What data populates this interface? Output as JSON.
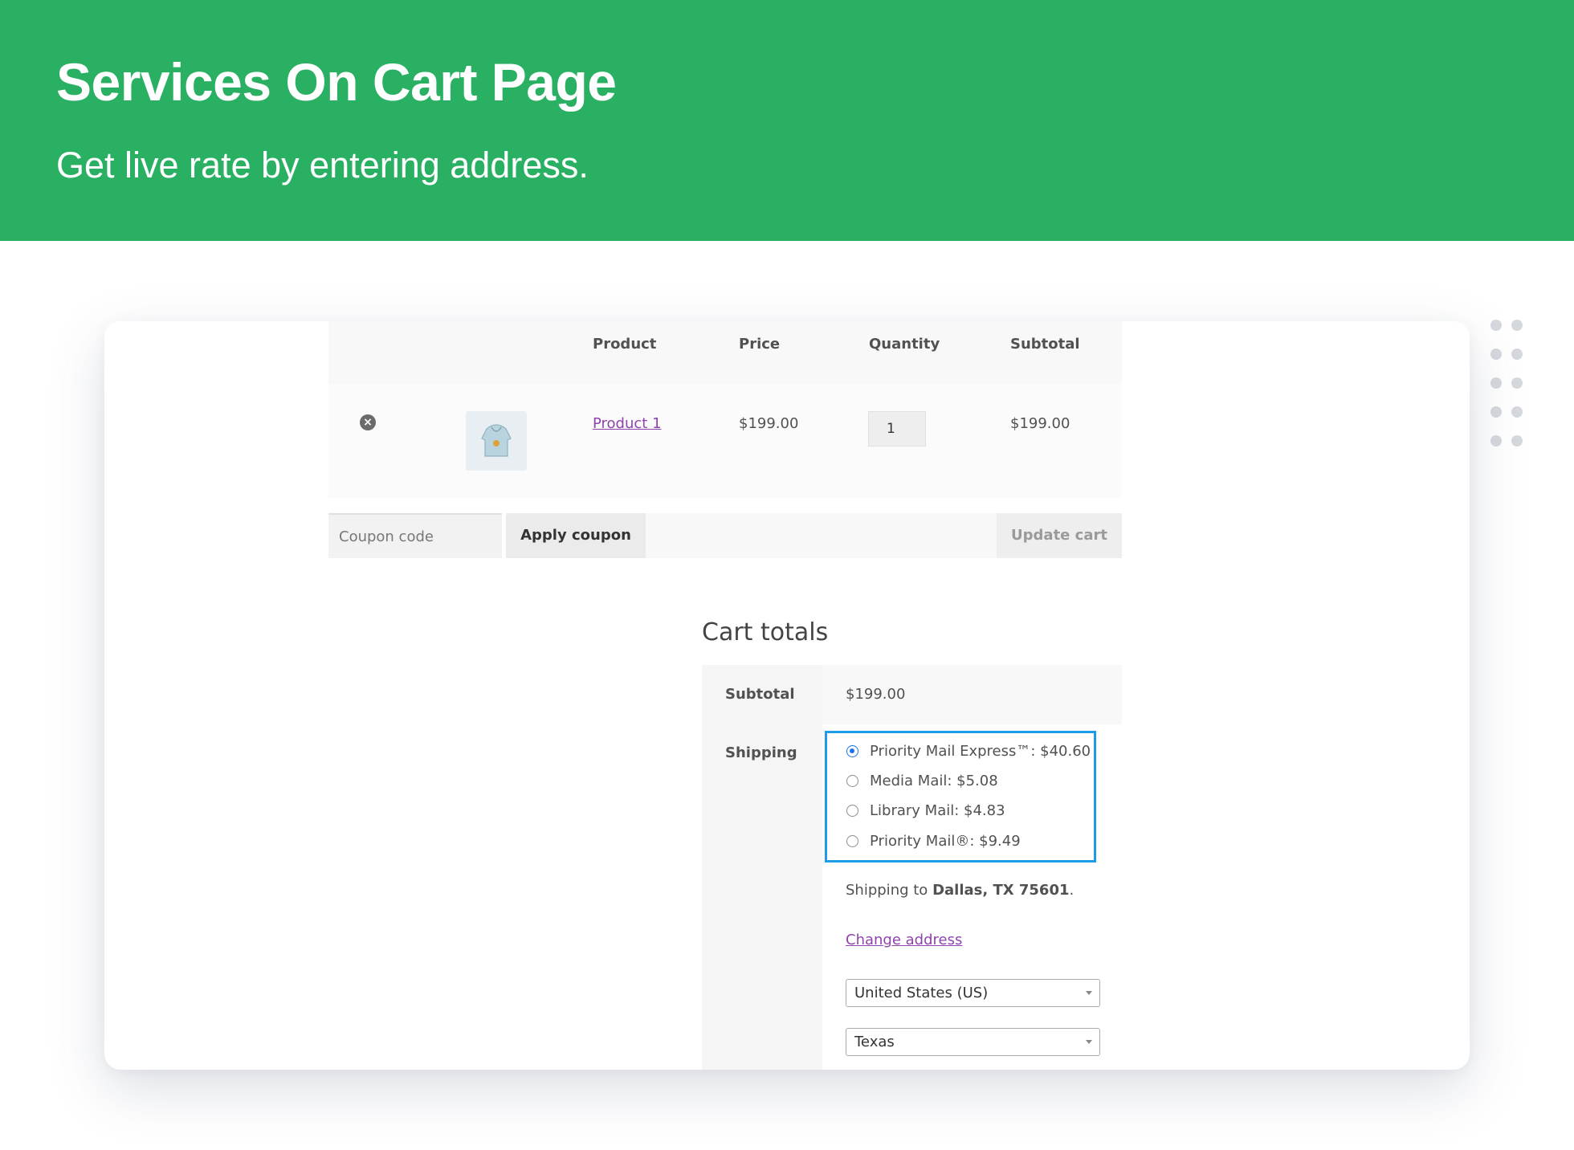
{
  "banner": {
    "title": "Services On Cart Page",
    "subtitle": "Get live rate by entering address.",
    "color": "#2ab063"
  },
  "cart": {
    "columns": [
      "Product",
      "Price",
      "Quantity",
      "Subtotal"
    ],
    "items": [
      {
        "name": "Product 1",
        "price": "$199.00",
        "quantity": "1",
        "subtotal": "$199.00",
        "remove_icon": "close-circle-icon",
        "thumbnail": "hoodie-thumbnail"
      }
    ],
    "coupon_placeholder": "Coupon code",
    "apply_coupon_label": "Apply coupon",
    "update_cart_label": "Update cart"
  },
  "totals": {
    "title": "Cart totals",
    "subtotal_label": "Subtotal",
    "subtotal_value": "$199.00",
    "shipping_label": "Shipping",
    "shipping_options": [
      {
        "label": "Priority Mail Express™: $40.60",
        "selected": true
      },
      {
        "label": "Media Mail: $5.08",
        "selected": false
      },
      {
        "label": "Library Mail: $4.83",
        "selected": false
      },
      {
        "label": "Priority Mail®: $9.49",
        "selected": false
      }
    ],
    "shipping_to_prefix": "Shipping to",
    "shipping_to_address": "Dallas, TX 75601",
    "shipping_to_suffix": ".",
    "change_address_label": "Change address",
    "country_value": "United States (US)",
    "state_value": "Texas",
    "highlight_color": "#1e9be8",
    "link_color": "#8e44ad"
  }
}
